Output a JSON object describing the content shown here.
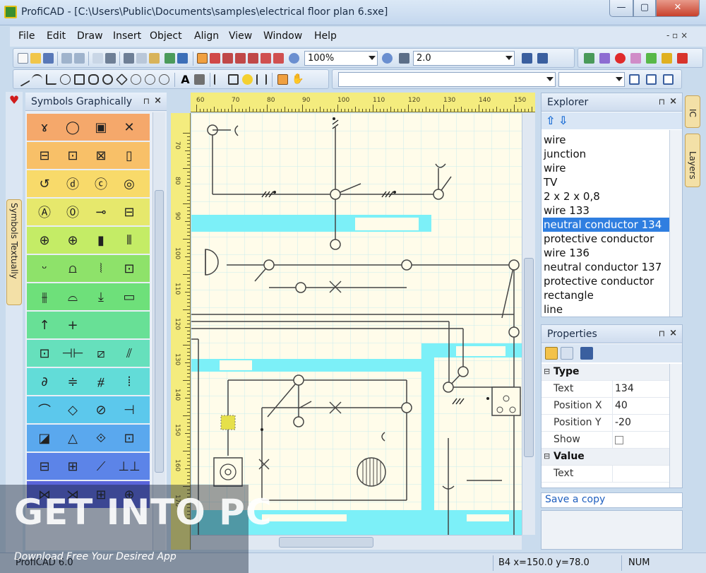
{
  "window": {
    "title": "ProfiCAD - [C:\\Users\\Public\\Documents\\samples\\electrical floor plan 6.sxe]",
    "controls": {
      "minimize": "—",
      "maximize": "▢",
      "close": "✕"
    }
  },
  "menu": {
    "items": [
      "File",
      "Edit",
      "Draw",
      "Insert",
      "Object",
      "Align",
      "View",
      "Window",
      "Help"
    ],
    "mdi_controls": "- ▫ ×"
  },
  "toolbar": {
    "zoom_value": "100%",
    "line_width_value": "2.0"
  },
  "left_tabs": {
    "heart_icon": "♥",
    "symbols_textually": "Symbols Textually"
  },
  "symbols_panel": {
    "title": "Symbols Graphically",
    "pin": "⊓",
    "close": "×",
    "row_colors": [
      "#f5a86b",
      "#f8c068",
      "#f8da6a",
      "#e6e86c",
      "#c4ec66",
      "#8ee26a",
      "#6ee07a",
      "#68e096",
      "#66e0bc",
      "#62dcd8",
      "#5cc8ec",
      "#5aa8ee",
      "#5c84e8",
      "#5a64da"
    ],
    "rows": [
      [
        "ɤ",
        "◯",
        "▣",
        "✕"
      ],
      [
        "⊟",
        "⊡",
        "⊠",
        "▯"
      ],
      [
        "↺",
        "ⓓ",
        "ⓒ",
        "◎"
      ],
      [
        "Ⓐ",
        "⓪",
        "⊸",
        "⊟"
      ],
      [
        "⊕",
        "⊕",
        "▮",
        "⦀"
      ],
      [
        "ᵕ",
        "⩍",
        "⦚",
        "⊡"
      ],
      [
        "⫵",
        "⌓",
        "⤓",
        "▭"
      ],
      [
        "↑",
        "+",
        "",
        ""
      ],
      [
        "⊡",
        "⊣⊢",
        "⧄",
        "⫽"
      ],
      [
        "∂",
        "≑",
        "⧣",
        "⦙"
      ],
      [
        "⌒",
        "◇",
        "⊘",
        "⊣"
      ],
      [
        "◪",
        "△",
        "⟐",
        "⊡"
      ],
      [
        "⊟",
        "⊞",
        "⟋",
        "⊥⊥"
      ],
      [
        "⋈",
        "⋊",
        "⊞",
        "⊕"
      ]
    ]
  },
  "ruler": {
    "top_labels": [
      "60",
      "70",
      "80",
      "90",
      "100",
      "110",
      "120",
      "130",
      "140",
      "150"
    ],
    "left_labels": [
      "70",
      "80",
      "90",
      "100",
      "110",
      "120",
      "130",
      "140",
      "150",
      "160",
      "170"
    ]
  },
  "explorer": {
    "title": "Explorer",
    "pin": "⊓",
    "close": "×",
    "up_icon": "⇧",
    "down_icon": "⇩",
    "items": [
      "wire",
      "junction",
      "wire",
      "TV",
      "2 x 2 x 0,8",
      "wire 133",
      "neutral conductor 134",
      "protective conductor",
      "wire 136",
      "neutral conductor 137",
      "protective conductor",
      "rectangle",
      "line"
    ],
    "selected_index": 6
  },
  "right_tabs": {
    "ic": "IC",
    "layers": "Layers"
  },
  "properties": {
    "title": "Properties",
    "pin": "⊓",
    "close": "×",
    "categories": [
      {
        "name": "Type",
        "toggle": "⊟",
        "rows": [
          {
            "key": "Text",
            "value": "134"
          },
          {
            "key": "Position X",
            "value": "40"
          },
          {
            "key": "Position Y",
            "value": "-20"
          },
          {
            "key": "Show",
            "value": ""
          }
        ]
      },
      {
        "name": "Value",
        "toggle": "⊟",
        "rows": [
          {
            "key": "Text",
            "value": ""
          }
        ]
      }
    ],
    "save_copy": "Save a copy"
  },
  "statusbar": {
    "left": "ProfiCAD 6.0",
    "coords": "B4  x=150.0  y=78.0",
    "mode": "NUM"
  },
  "watermark": {
    "brand": "GET INTO PC",
    "tagline": "Download Free Your Desired App"
  },
  "colors": {
    "selection": "#2f7ee0",
    "ruler": "#f4ec7e",
    "canvas": "#fffcea",
    "wall": "#7cf0f8",
    "grid": "#c9ecef"
  }
}
